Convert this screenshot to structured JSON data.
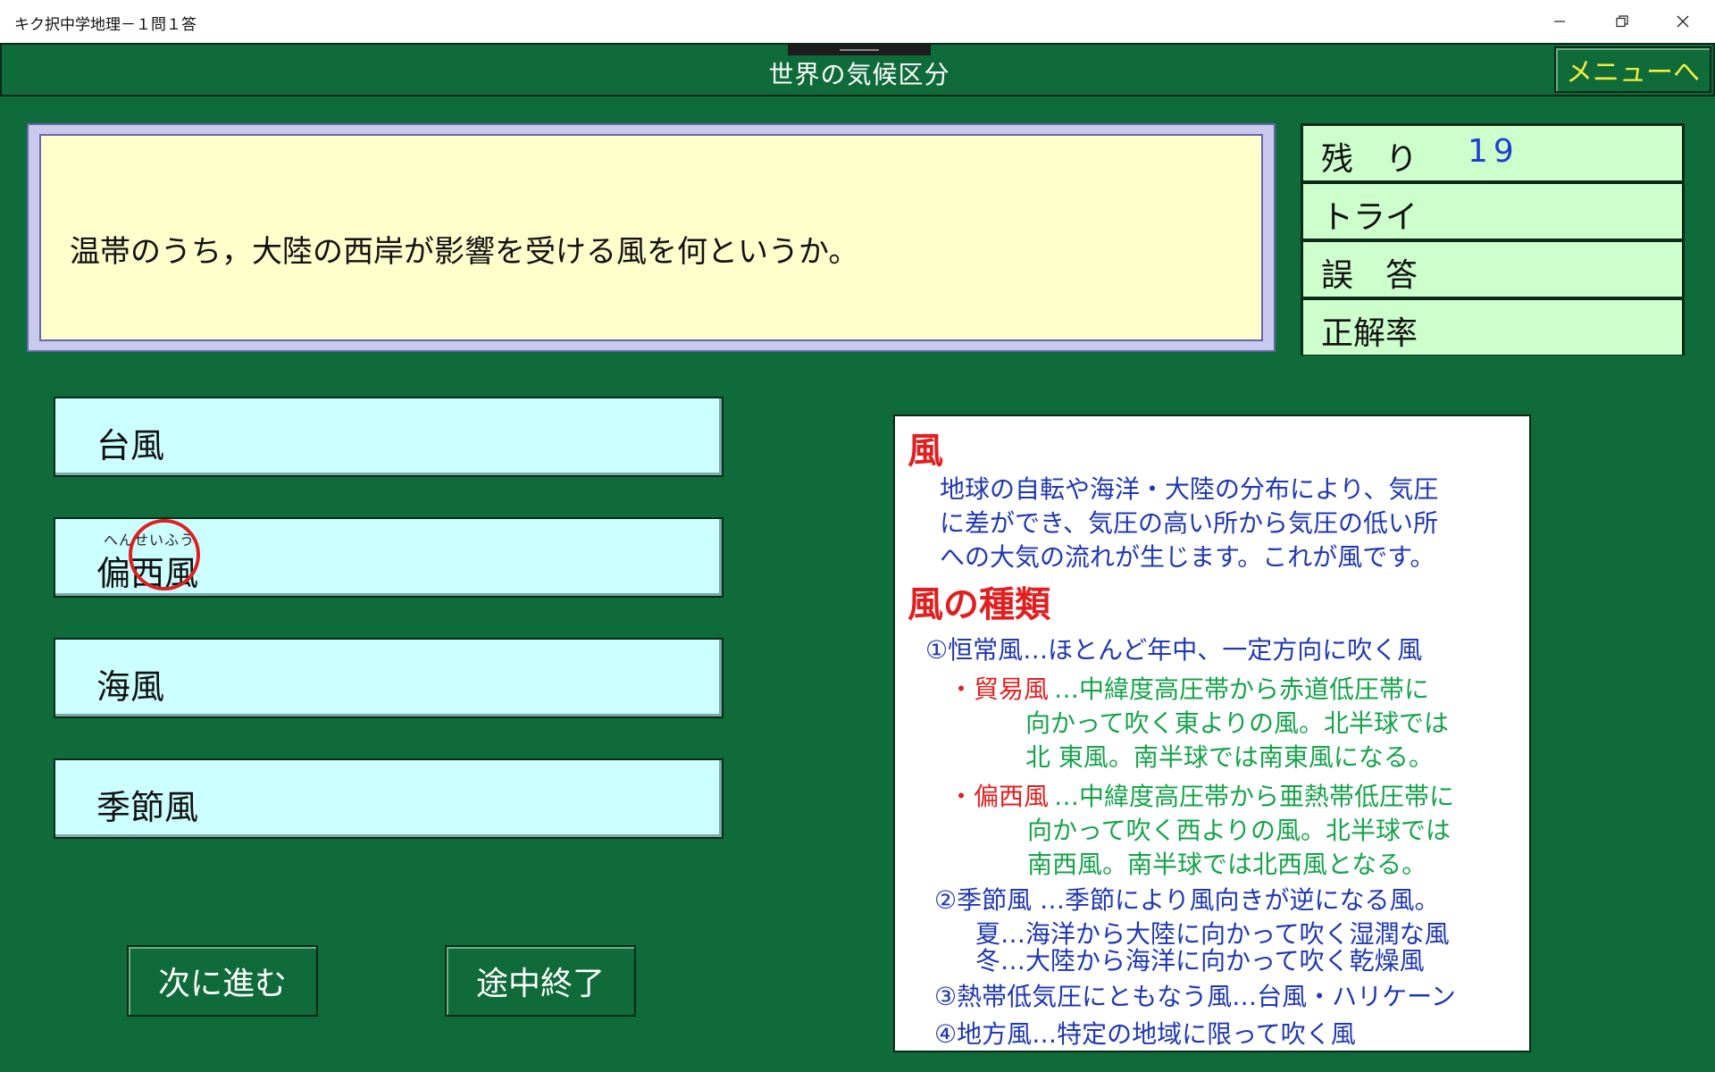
{
  "window": {
    "title": "キク択中学地理－１問１答"
  },
  "header": {
    "title": "世界の気候区分",
    "menu_button": "メニューへ"
  },
  "question": {
    "text": "温帯のうち，大陸の西岸が影響を受ける風を何というか。"
  },
  "stats": {
    "remaining_label": "残　り",
    "remaining_value": "19",
    "try_label": "トライ",
    "wrong_label": "誤　答",
    "rate_label": "正解率"
  },
  "choices": [
    {
      "label": "台風"
    },
    {
      "label": "偏西風",
      "ruby": "へんせいふう",
      "selected": true
    },
    {
      "label": "海風"
    },
    {
      "label": "季節風"
    }
  ],
  "buttons": {
    "next": "次に進む",
    "quit": "途中終了"
  },
  "explanation": {
    "heading": "風",
    "intro": [
      "地球の自転や海洋・大陸の分布により、気圧",
      "に差ができ、気圧の高い所から気圧の低い所",
      "への大気の流れが生じます。これが風です。"
    ],
    "types_heading": "風の種類",
    "item1": "①恒常風…ほとんど年中、一定方向に吹く風",
    "trade_name": "・貿易風",
    "trade_desc": [
      "…中緯度高圧帯から赤道低圧帯に",
      "向かって吹く東よりの風。北半球では",
      "北 東風。南半球では南東風になる。"
    ],
    "west_name": "・偏西風",
    "west_desc": [
      "…中緯度高圧帯から亜熱帯低圧帯に",
      "向かって吹く西よりの風。北半球では",
      "南西風。南半球では北西風となる。"
    ],
    "item2": "②季節風 …季節により風向きが逆になる風。",
    "summer": "夏…海洋から大陸に向かって吹く湿潤な風",
    "winter": "冬…大陸から海洋に向かって吹く乾燥風",
    "item3": "③熱帯低気圧にともなう風…台風・ハリケーン",
    "item4": "④地方風…特定の地域に限って吹く風"
  },
  "colors": {
    "background": "#0f6b3a",
    "menu_text": "#f4ee3c",
    "question_bg": "#ffffcc",
    "stats_bg": "#ccffcc",
    "choice_bg": "#ccffff",
    "highlight_red": "#e02020",
    "text_blue": "#2038b0",
    "text_green": "#16a34a"
  }
}
